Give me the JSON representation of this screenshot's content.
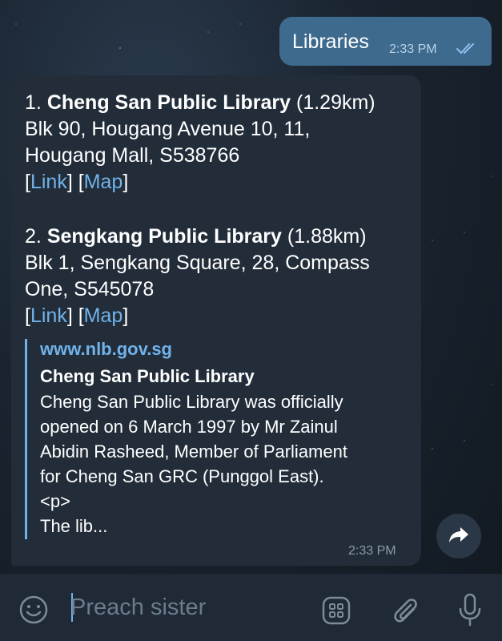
{
  "outgoing": {
    "text": "Libraries",
    "time": "2:33 PM"
  },
  "incoming": {
    "lines": [
      {
        "num": "1.",
        "name": "Cheng San Public Library",
        "dist": "(1.29km)"
      },
      {
        "num": "2.",
        "name": "Sengkang Public Library",
        "dist": "(1.88km)"
      }
    ],
    "results": [
      {
        "address_line1": "Blk 90, Hougang Avenue 10, 11,",
        "address_line2": "Hougang Mall, S538766",
        "link_label": "Link",
        "map_label": "Map"
      },
      {
        "address_line1": "Blk 1, Sengkang Square, 28, Compass",
        "address_line2": "One, S545078",
        "link_label": "Link",
        "map_label": "Map"
      }
    ],
    "preview": {
      "site": "www.nlb.gov.sg",
      "title": "Cheng San Public Library",
      "desc_lines": [
        "Cheng San Public Library was officially",
        "opened on 6 March 1997 by Mr Zainul",
        "Abidin Rasheed, Member of Parliament",
        "for Cheng San GRC (Punggol East).",
        "<p>",
        "The lib..."
      ]
    },
    "time": "2:33 PM"
  },
  "composer": {
    "placeholder": "Preach sister"
  },
  "icons": {
    "emoji": "emoji-icon",
    "bot_commands": "bot-commands-icon",
    "attach": "paperclip-icon",
    "mic": "microphone-icon",
    "forward": "forward-icon",
    "read": "double-check-icon"
  },
  "colors": {
    "outgoing_bubble": "#3e6a8e",
    "incoming_bubble": "#222d39",
    "link": "#71b2ea"
  }
}
